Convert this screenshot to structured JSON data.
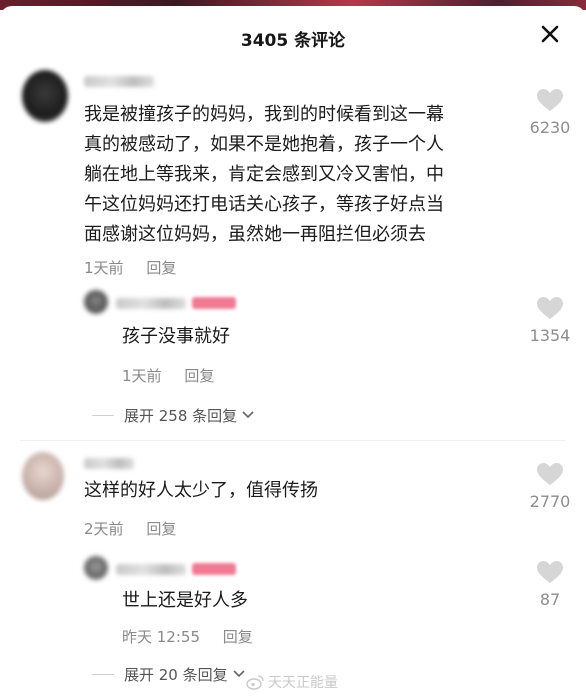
{
  "header": {
    "title": "3405 条评论",
    "close_icon": "close-icon"
  },
  "comments": [
    {
      "text_lines": [
        "我是被撞孩子的妈妈，我到的时候看到这一幕",
        "真的被感动了，如果不是她抱着，孩子一个人",
        "躺在地上等我来，肯定会感到又冷又害怕，中",
        "午这位妈妈还打电话关心孩子，等孩子好点当",
        "面感谢这位妈妈，虽然她一再阻拦但必须去"
      ],
      "time": "1天前",
      "reply_label": "回复",
      "likes": "6230"
    },
    {
      "text_lines": [
        "孩子没事就好"
      ],
      "time": "1天前",
      "reply_label": "回复",
      "likes": "1354"
    },
    {
      "text_lines": [
        "这样的好人太少了，值得传扬"
      ],
      "time": "2天前",
      "reply_label": "回复",
      "likes": "2770"
    },
    {
      "text_lines": [
        "世上还是好人多"
      ],
      "time": "昨天 12:55",
      "reply_label": "回复",
      "likes": "87"
    }
  ],
  "expand_1": {
    "label": "展开 258 条回复"
  },
  "expand_2": {
    "label": "展开 20 条回复"
  },
  "watermark": {
    "text": "天天正能量"
  },
  "colors": {
    "like_icon": "#d6d6d6",
    "badge": "#f07a93",
    "meta": "#8a8a8a"
  }
}
